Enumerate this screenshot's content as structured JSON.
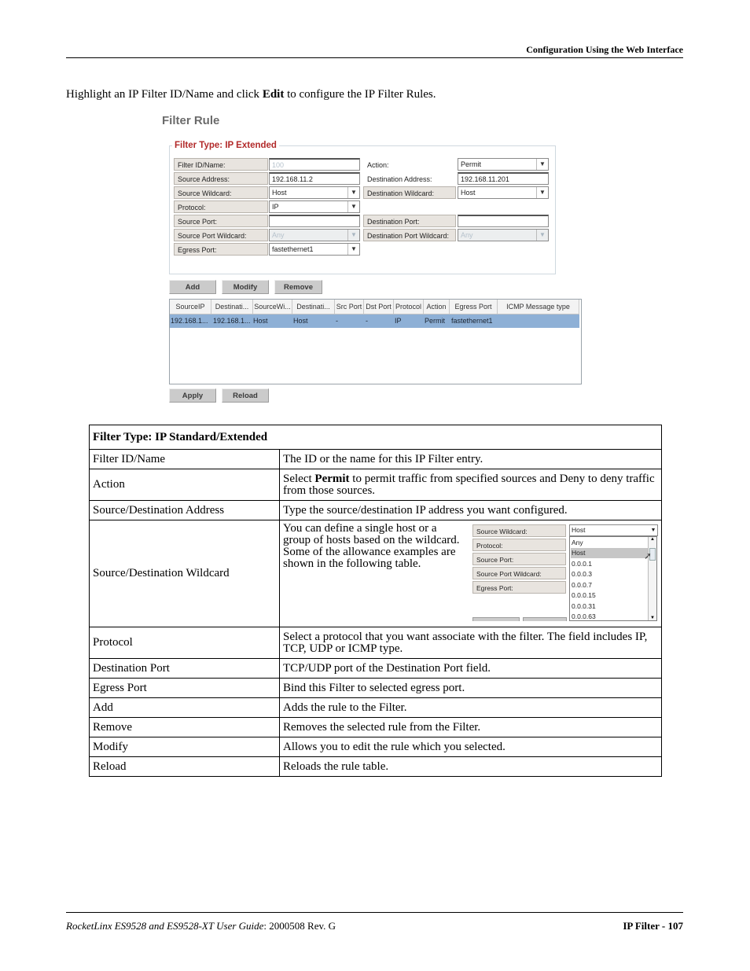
{
  "header": {
    "title": "Configuration Using the Web Interface"
  },
  "intro": {
    "before": "Highlight an IP Filter ID/Name and click ",
    "bold": "Edit",
    "after": " to configure the IP Filter Rules."
  },
  "ui": {
    "page_title": "Filter Rule",
    "section_title": "Filter Type: IP Extended",
    "fields": {
      "filter_id_label": "Filter ID/Name:",
      "filter_id_value": "100",
      "action_label": "Action:",
      "action_value": "Permit",
      "src_addr_label": "Source Address:",
      "src_addr_value": "192.168.11.2",
      "dst_addr_label": "Destination Address:",
      "dst_addr_value": "192.168.11.201",
      "src_wc_label": "Source Wildcard:",
      "src_wc_value": "Host",
      "dst_wc_label": "Destination Wildcard:",
      "dst_wc_value": "Host",
      "protocol_label": "Protocol:",
      "protocol_value": "IP",
      "src_port_label": "Source Port:",
      "src_port_value": "",
      "dst_port_label": "Destination Port:",
      "dst_port_value": "",
      "src_port_wc_label": "Source Port Wildcard:",
      "src_port_wc_value": "Any",
      "dst_port_wc_label": "Destination Port Wildcard:",
      "dst_port_wc_value": "Any",
      "egress_label": "Egress Port:",
      "egress_value": "fastethernet1"
    },
    "buttons": {
      "add": "Add",
      "modify": "Modify",
      "remove": "Remove",
      "apply": "Apply",
      "reload": "Reload"
    },
    "grid": {
      "columns": [
        "SourceIP",
        "Destinati...",
        "SourceWi...",
        "Destinati...",
        "Src Port",
        "Dst Port",
        "Protocol",
        "Action",
        "Egress Port",
        "ICMP Message type"
      ],
      "rows": [
        [
          "192.168.1...",
          "192.168.1...",
          "Host",
          "Host",
          "-",
          "-",
          "IP",
          "Permit",
          "fastethernet1",
          ""
        ]
      ]
    }
  },
  "desc_table": {
    "header": "Filter Type: IP Standard/Extended",
    "rows": [
      {
        "term": "Filter ID/Name",
        "desc": "The ID or the name for this IP Filter entry."
      },
      {
        "term": "Action",
        "desc_before": "Select ",
        "desc_bold": "Permit",
        "desc_after": " to permit traffic from specified sources and Deny to deny traffic from those sources."
      },
      {
        "term": "Source/Destination Address",
        "desc": "Type the source/destination IP address you want configured."
      },
      {
        "term": "Source/Destination Wildcard",
        "desc": "You can define a single host or a group of hosts based on the wildcard. Some of the allowance examples are shown in the following table."
      },
      {
        "term": "Protocol",
        "desc": "Select a protocol that you want associate with the filter. The field includes IP, TCP, UDP or ICMP type."
      },
      {
        "term": "Destination Port",
        "desc": "TCP/UDP port of the Destination Port field."
      },
      {
        "term": "Egress Port",
        "desc": "Bind this Filter to selected egress port."
      },
      {
        "term": "Add",
        "desc": "Adds the rule to the Filter."
      },
      {
        "term": "Remove",
        "desc": "Removes the selected rule from the Filter."
      },
      {
        "term": "Modify",
        "desc": "Allows you to edit the rule which you selected."
      },
      {
        "term": "Reload",
        "desc": "Reloads the rule table."
      }
    ]
  },
  "mini": {
    "labels": [
      "Source Wildcard:",
      "Protocol:",
      "Source Port:",
      "Source Port Wildcard:",
      "Egress Port:"
    ],
    "selected": "Host",
    "options": [
      "Any",
      "Host",
      "0.0.0.1",
      "0.0.0.3",
      "0.0.0.7",
      "0.0.0.15",
      "0.0.0.31",
      "0.0.0.63"
    ],
    "highlighted": "Host"
  },
  "footer": {
    "left_italic": "RocketLinx ES9528 and ES9528-XT User Guide",
    "left_rest": ": 2000508 Rev. G",
    "right": "IP Filter - 107"
  }
}
